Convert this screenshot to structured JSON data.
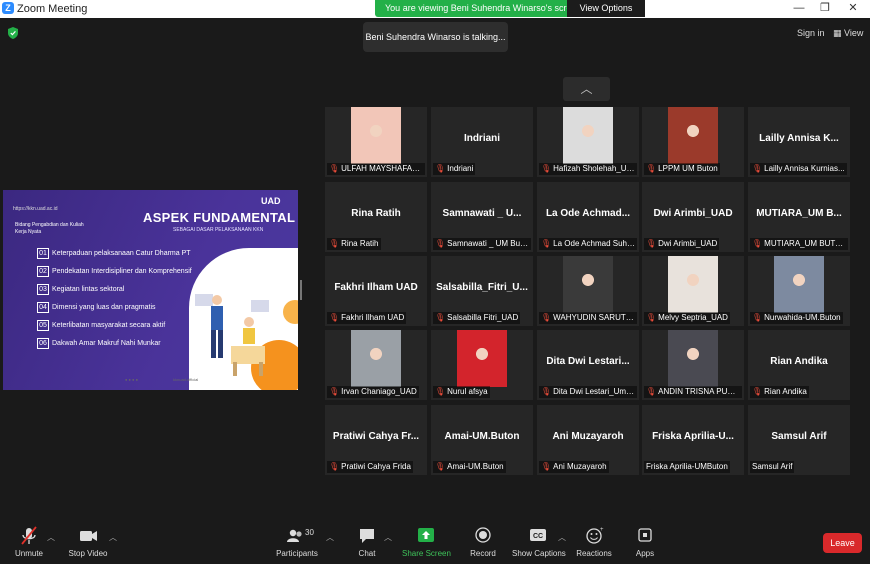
{
  "window": {
    "title": "Zoom Meeting"
  },
  "share_banner": {
    "text": "You are viewing Beni Suhendra Winarso's screen",
    "view_options": "View Options"
  },
  "talking": "Beni Suhendra Winarso is talking...",
  "top_right": {
    "sign_in": "Sign in",
    "view": "View"
  },
  "slide": {
    "url": "https://kkn.uad.ac.id",
    "bidang": "Bidang Pengabdian dan Kuliah Kerja Nyata",
    "heading": "ASPEK FUNDAMENTAL",
    "subheading": "SEBAGAI DASAR PELAKSANAAN KKN",
    "logo": "UAD",
    "items": [
      {
        "num": "01",
        "text": "Keterpaduan pelaksanaan Catur Dharma PT"
      },
      {
        "num": "02",
        "text": "Pendekatan Interdisipliner dan Komprehensif"
      },
      {
        "num": "03",
        "text": "Kegiatan lintas sektoral"
      },
      {
        "num": "04",
        "text": "Dimensi yang luas dan pragmatis"
      },
      {
        "num": "05",
        "text": "Keterlibatan masyarakat secara aktif"
      },
      {
        "num": "06",
        "text": "Dakwah Amar Makruf Nahi Munkar"
      }
    ],
    "footer": "kknuad.official"
  },
  "tiles": [
    {
      "big": "",
      "label": "ULFAH MAYSHAFARA ...",
      "muted": true,
      "photo": "#f2c6b8"
    },
    {
      "big": "Indriani",
      "label": "Indriani",
      "muted": true
    },
    {
      "big": "",
      "label": "Hafizah Sholehah_UM...",
      "muted": true,
      "photo": "#dcdcdc"
    },
    {
      "big": "",
      "label": "LPPM UM Buton",
      "muted": true,
      "photo": "#9b3a2b"
    },
    {
      "big": "Lailly Annisa K...",
      "label": "Lailly Annisa Kurnias...",
      "muted": true
    },
    {
      "big": "Rina Ratih",
      "label": "Rina Ratih",
      "muted": true
    },
    {
      "big": "Samnawati _ U...",
      "label": "Samnawati _ UM Buton",
      "muted": true
    },
    {
      "big": "La Ode Achmad...",
      "label": "La Ode Achmad Suhe...",
      "muted": true
    },
    {
      "big": "Dwi Arimbi_UAD",
      "label": "Dwi Arimbi_UAD",
      "muted": true
    },
    {
      "big": "MUTIARA_UM B...",
      "label": "MUTIARA_UM BUTON",
      "muted": true
    },
    {
      "big": "Fakhri Ilham UAD",
      "label": "Fakhri Ilham UAD",
      "muted": true
    },
    {
      "big": "Salsabilla_Fitri_U...",
      "label": "Salsabilla Fitri_UAD",
      "muted": true
    },
    {
      "big": "",
      "label": "WAHYUDIN SARUTRA",
      "muted": true,
      "photo": "#3a3a3a"
    },
    {
      "big": "",
      "label": "Melvy Septria_UAD",
      "muted": true,
      "photo": "#e8e2dc"
    },
    {
      "big": "",
      "label": "Nurwahida-UM.Buton",
      "muted": true,
      "photo": "#7d8aa0"
    },
    {
      "big": "",
      "label": "Irvan Chaniago_UAD",
      "muted": true,
      "photo": "#9aa0a6"
    },
    {
      "big": "",
      "label": "Nurul afsya",
      "muted": true,
      "photo": "#d3242c"
    },
    {
      "big": "Dita Dwi Lestari...",
      "label": "Dita Dwi Lestari_UmB...",
      "muted": true
    },
    {
      "big": "",
      "label": "ANDIN TRISNA PUTRI...",
      "muted": true,
      "photo": "#4a4a52"
    },
    {
      "big": "Rian Andika",
      "label": "Rian Andika",
      "muted": true
    },
    {
      "big": "Pratiwi Cahya Fr...",
      "label": "Pratiwi Cahya Frida",
      "muted": true
    },
    {
      "big": "Amai-UM.Buton",
      "label": "Amai-UM.Buton",
      "muted": true
    },
    {
      "big": "Ani Muzayaroh",
      "label": "Ani Muzayaroh",
      "muted": true
    },
    {
      "big": "Friska Aprilia-U...",
      "label": "Friska Aprilia-UMButon",
      "muted": false
    },
    {
      "big": "Samsul Arif",
      "label": "Samsul Arif",
      "muted": false
    }
  ],
  "toolbar": {
    "unmute": "Unmute",
    "stop_video": "Stop Video",
    "participants": "Participants",
    "participants_count": "30",
    "chat": "Chat",
    "share_screen": "Share Screen",
    "record": "Record",
    "show_captions": "Show Captions",
    "captions_icon": "CC",
    "reactions": "Reactions",
    "apps": "Apps",
    "leave": "Leave"
  },
  "colors": {
    "share_green": "#23b048",
    "leave_red": "#d9292b",
    "zoom_blue": "#2d8cff"
  }
}
